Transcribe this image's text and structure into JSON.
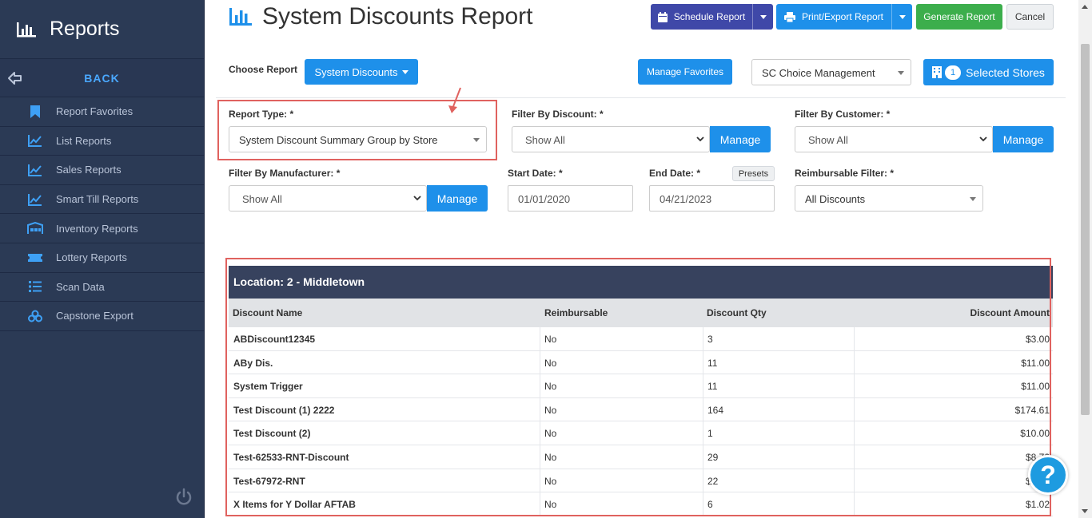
{
  "sidebar": {
    "title": "Reports",
    "back_label": "BACK",
    "items": [
      {
        "label": "Report Favorites",
        "icon": "bookmark-icon"
      },
      {
        "label": "List Reports",
        "icon": "line-chart-icon"
      },
      {
        "label": "Sales Reports",
        "icon": "line-chart-icon"
      },
      {
        "label": "Smart Till Reports",
        "icon": "line-chart-icon"
      },
      {
        "label": "Inventory Reports",
        "icon": "warehouse-icon"
      },
      {
        "label": "Lottery Reports",
        "icon": "ticket-icon"
      },
      {
        "label": "Scan Data",
        "icon": "list-icon"
      },
      {
        "label": "Capstone Export",
        "icon": "boxes-icon"
      }
    ]
  },
  "header": {
    "title": "System Discounts Report",
    "schedule_label": "Schedule Report",
    "print_label": "Print/Export Report",
    "generate_label": "Generate Report",
    "cancel_label": "Cancel"
  },
  "toolbar": {
    "choose_label": "Choose Report",
    "report_button": "System Discounts",
    "favorites_label": "Manage Favorites",
    "company_select": "SC Choice Management",
    "stores_count": "1",
    "stores_label": "Selected Stores"
  },
  "filters": {
    "report_type_label": "Report Type: *",
    "report_type_value": "System Discount Summary Group by Store",
    "discount_label": "Filter By Discount: *",
    "discount_value": "Show All",
    "customer_label": "Filter By Customer: *",
    "customer_value": "Show All",
    "manufacturer_label": "Filter By Manufacturer: *",
    "manufacturer_value": "Show All",
    "manage_label": "Manage",
    "start_label": "Start Date: *",
    "start_value": "01/01/2020",
    "end_label": "End Date: *",
    "end_value": "04/21/2023",
    "presets_label": "Presets",
    "reimb_label": "Reimbursable Filter: *",
    "reimb_value": "All Discounts"
  },
  "table": {
    "location": "Location: 2 - Middletown",
    "columns": [
      "Discount Name",
      "Reimbursable",
      "Discount Qty",
      "Discount Amount"
    ],
    "rows": [
      [
        "ABDiscount12345",
        "No",
        "3",
        "$3.00"
      ],
      [
        "ABy Dis.",
        "No",
        "11",
        "$11.00"
      ],
      [
        "System Trigger",
        "No",
        "11",
        "$11.00"
      ],
      [
        "Test Discount (1) 2222",
        "No",
        "164",
        "$174.61"
      ],
      [
        "Test Discount (2)",
        "No",
        "1",
        "$10.00"
      ],
      [
        "Test-62533-RNT-Discount",
        "No",
        "29",
        "$8.70"
      ],
      [
        "Test-67972-RNT",
        "No",
        "22",
        "$7.00"
      ],
      [
        "X Items for Y Dollar AFTAB",
        "No",
        "6",
        "$1.02"
      ]
    ]
  },
  "colors": {
    "sidebar_bg": "#2b3a55",
    "primary_blue": "#1e90ea",
    "schedule_indigo": "#3f48a8",
    "generate_green": "#3cae4c",
    "highlight_red": "#e0625f"
  }
}
